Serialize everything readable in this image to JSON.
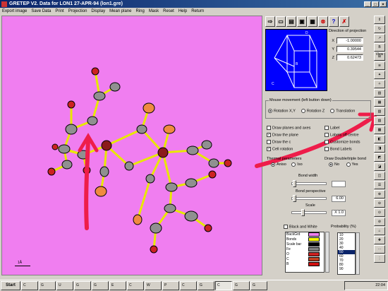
{
  "window": {
    "title": "GRETEP V2. Data for   LON1 27-APR-94 (lon1.gre)",
    "min": "_",
    "max": "□",
    "close": "×"
  },
  "menu": [
    "Export image",
    "Save Data",
    "Print",
    "Projection",
    "Display",
    "Mean plane",
    "Ring",
    "Mask",
    "Reset",
    "Help",
    "Return"
  ],
  "canvas": {
    "background": "#f07ef0",
    "scale_label": "1Å"
  },
  "toolbar": {
    "icons": [
      "arrow-icon",
      "camera-icon",
      "print-icon",
      "disk-icon",
      "open-icon",
      "stop-icon",
      "help-icon",
      "close-icon"
    ],
    "glyphs": [
      "⇨",
      "▭",
      "▤",
      "▣",
      "▦",
      "⊗",
      "?",
      "✗"
    ]
  },
  "projection": {
    "title": "Direction of projection",
    "x_label": "X",
    "x_value": "-1.00000",
    "y_label": "Y",
    "y_value": "0.39544",
    "z_label": "Z",
    "z_value": "0.62473",
    "cube_labels": [
      "D",
      "B",
      "C"
    ]
  },
  "mouse": {
    "title": "Mouse movement (left button down)",
    "options": [
      "Rotation X,Y",
      "Rotation Z",
      "Translation"
    ],
    "selected": "Rotation X,Y"
  },
  "options_left": [
    {
      "label": "Draw planes and axes",
      "checked": false
    },
    {
      "label": "Draw the plane",
      "checked": true
    },
    {
      "label": "Draw the c",
      "checked": false
    },
    {
      "label": "Cell rotation",
      "checked": true
    }
  ],
  "options_right": [
    {
      "label": "Label",
      "checked": false
    },
    {
      "label": "Labels off centre",
      "checked": false
    },
    {
      "label": "Customize  bonds",
      "checked": false
    },
    {
      "label": "Bond Labels",
      "checked": false
    }
  ],
  "thermal": {
    "title": "Thermal parameters",
    "opt1": "Aniso",
    "opt2": "Iso"
  },
  "double_bonds": {
    "title": "Draw Double/triple bond",
    "opt1": "No",
    "opt2": "Yes"
  },
  "bond_width": {
    "label": "Bond width",
    "value": ""
  },
  "bond_perspective": {
    "label": "Bond perspective",
    "value": "6.00"
  },
  "scale": {
    "label": "Scale",
    "value": "X 1.0"
  },
  "black_white": {
    "label": "Black and White",
    "checked": false
  },
  "colors": [
    {
      "name": "BackGrd",
      "color": "#f07ef0"
    },
    {
      "name": "Bonds",
      "color": "#ffff00"
    },
    {
      "name": "Scale bar",
      "color": "#000000"
    },
    {
      "name": "Fe",
      "color": "#808080"
    },
    {
      "name": "O",
      "color": "#cc2222"
    },
    {
      "name": "C",
      "color": "#c04020"
    },
    {
      "name": "B",
      "color": "#d01010"
    }
  ],
  "probability": {
    "label": "Probability (%)",
    "items": [
      "10",
      "20",
      "30",
      "40",
      "50",
      "60",
      "70",
      "80",
      "90"
    ],
    "selected": "50"
  },
  "sidebar": [
    "⇕",
    "↻",
    "↗",
    "B View",
    "⊞",
    "≋",
    "✦",
    "✧",
    "▥",
    "▦",
    "▧",
    "▨",
    "▩",
    "◧",
    "◨",
    "◩",
    "◪",
    "◫",
    "☰",
    "⊕",
    "⊖",
    "⊙",
    "⊘",
    "⌂",
    "✚",
    "⋯",
    "⋮"
  ],
  "taskbar": {
    "start": "Start",
    "buttons": [
      "C",
      "G",
      "U",
      "G",
      "G",
      "E",
      "C",
      "W",
      "P",
      "C",
      "G",
      "C",
      "G",
      "G"
    ],
    "active_index": 11,
    "clock": "22:04"
  }
}
